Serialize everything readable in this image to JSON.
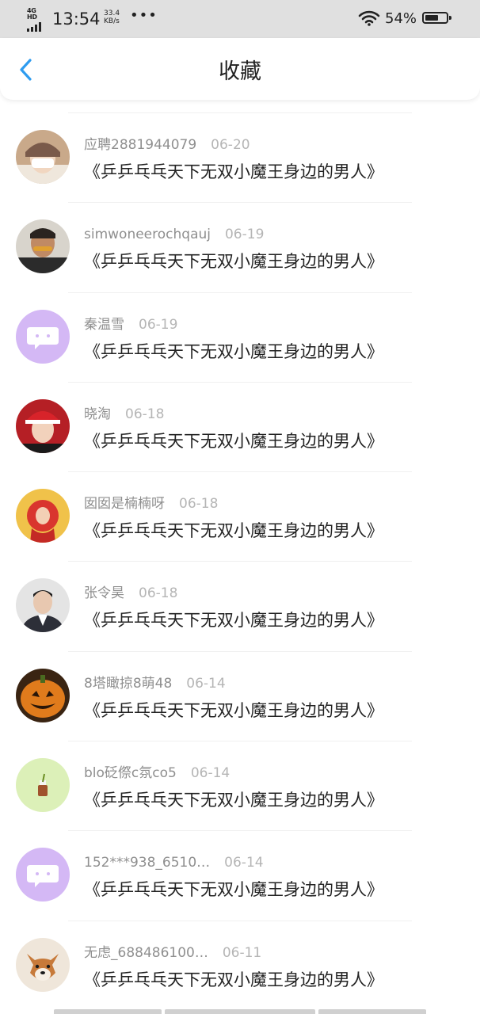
{
  "status_bar": {
    "network": "4G HD",
    "time": "13:54",
    "speed_value": "33.4",
    "speed_unit": "KB/s",
    "more": "•••",
    "battery_pct": "54%",
    "battery_level": 0.54,
    "icons": [
      "signal-icon",
      "wifi-icon",
      "battery-icon"
    ]
  },
  "header": {
    "title": "收藏",
    "back_icon": "chevron-left-icon",
    "accent": "#2e9cf0"
  },
  "items": [
    {
      "user": "应聘2881944079",
      "date": "06-20",
      "title": "《乒乒乓乓天下无双小魔王身边的男人》",
      "avatar": "photo-girl-cap"
    },
    {
      "user": "simwoneerochqauj",
      "date": "06-19",
      "title": "《乒乒乓乓天下无双小魔王身边的男人》",
      "avatar": "photo-person"
    },
    {
      "user": "秦温雪",
      "date": "06-19",
      "title": "《乒乒乓乓天下无双小魔王身边的男人》",
      "avatar": "default-chat-icon"
    },
    {
      "user": "晓淘",
      "date": "06-18",
      "title": "《乒乒乓乓天下无双小魔王身边的男人》",
      "avatar": "photo-red-helmet"
    },
    {
      "user": "囡囡是楠楠呀",
      "date": "06-18",
      "title": "《乒乒乓乓天下无双小魔王身边的男人》",
      "avatar": "photo-red-yellow"
    },
    {
      "user": "张令昊",
      "date": "06-18",
      "title": "《乒乒乓乓天下无双小魔王身边的男人》",
      "avatar": "photo-man-suit"
    },
    {
      "user": "8塔瞰掠8萌48",
      "date": "06-14",
      "title": "《乒乒乓乓天下无双小魔王身边的男人》",
      "avatar": "photo-pumpkin"
    },
    {
      "user": "blo砭傺c氛co5",
      "date": "06-14",
      "title": "《乒乒乓乓天下无双小魔王身边的男人》",
      "avatar": "photo-drink-green"
    },
    {
      "user": "152***938_6510…",
      "date": "06-14",
      "title": "《乒乒乓乓天下无双小魔王身边的男人》",
      "avatar": "default-chat-icon"
    },
    {
      "user": "无虑_688486100…",
      "date": "06-11",
      "title": "《乒乒乓乓天下无双小魔王身边的男人》",
      "avatar": "photo-shiba-dog"
    }
  ],
  "colors": {
    "status_bar_bg": "#e0e0e0",
    "username": "#8f8f8f",
    "date": "#b5b5b5",
    "title": "#222222",
    "default_avatar": "#d4b8f5"
  }
}
